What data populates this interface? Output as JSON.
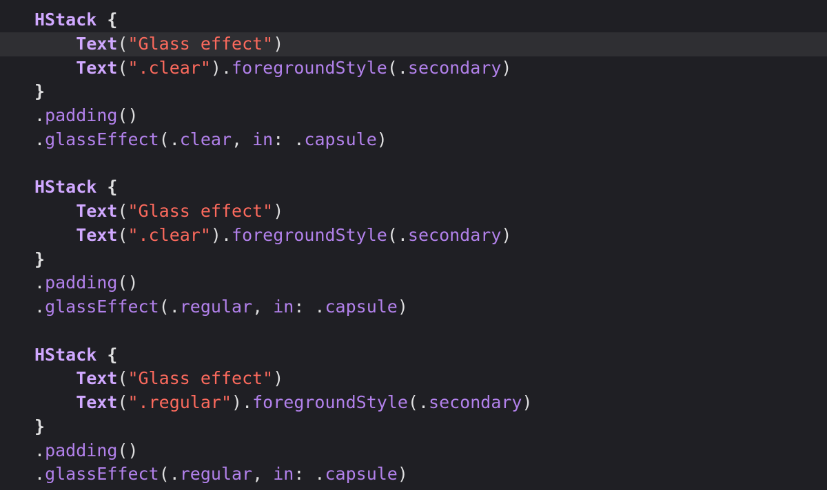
{
  "editor": {
    "theme": {
      "background": "#1f1f24",
      "current_line": "#2f2f33",
      "plain": "#dfdfe0",
      "type": "#d0a8ff",
      "string": "#fc6a5d",
      "method": "#b281eb",
      "keyword": "#fc5fa3"
    },
    "current_line_index": 1,
    "lines": [
      {
        "indent": 0,
        "tokens": [
          {
            "kind": "type",
            "text": "HStack"
          },
          {
            "kind": "plain",
            "text": " "
          },
          {
            "kind": "brace",
            "text": "{"
          }
        ]
      },
      {
        "indent": 1,
        "tokens": [
          {
            "kind": "type",
            "text": "Text"
          },
          {
            "kind": "plain",
            "text": "("
          },
          {
            "kind": "string",
            "text": "\"Glass effect\""
          },
          {
            "kind": "plain",
            "text": ")"
          }
        ]
      },
      {
        "indent": 1,
        "tokens": [
          {
            "kind": "type",
            "text": "Text"
          },
          {
            "kind": "plain",
            "text": "("
          },
          {
            "kind": "string",
            "text": "\".clear\""
          },
          {
            "kind": "plain",
            "text": ")."
          },
          {
            "kind": "method",
            "text": "foregroundStyle"
          },
          {
            "kind": "plain",
            "text": "(."
          },
          {
            "kind": "method",
            "text": "secondary"
          },
          {
            "kind": "plain",
            "text": ")"
          }
        ]
      },
      {
        "indent": 0,
        "tokens": [
          {
            "kind": "brace",
            "text": "}"
          }
        ]
      },
      {
        "indent": 0,
        "tokens": [
          {
            "kind": "plain",
            "text": "."
          },
          {
            "kind": "method",
            "text": "padding"
          },
          {
            "kind": "plain",
            "text": "()"
          }
        ]
      },
      {
        "indent": 0,
        "tokens": [
          {
            "kind": "plain",
            "text": "."
          },
          {
            "kind": "method",
            "text": "glassEffect"
          },
          {
            "kind": "plain",
            "text": "(."
          },
          {
            "kind": "method",
            "text": "clear"
          },
          {
            "kind": "plain",
            "text": ", "
          },
          {
            "kind": "method",
            "text": "in"
          },
          {
            "kind": "plain",
            "text": ": ."
          },
          {
            "kind": "method",
            "text": "capsule"
          },
          {
            "kind": "plain",
            "text": ")"
          }
        ]
      },
      {
        "indent": 0,
        "tokens": []
      },
      {
        "indent": 0,
        "tokens": [
          {
            "kind": "type",
            "text": "HStack"
          },
          {
            "kind": "plain",
            "text": " "
          },
          {
            "kind": "brace",
            "text": "{"
          }
        ]
      },
      {
        "indent": 1,
        "tokens": [
          {
            "kind": "type",
            "text": "Text"
          },
          {
            "kind": "plain",
            "text": "("
          },
          {
            "kind": "string",
            "text": "\"Glass effect\""
          },
          {
            "kind": "plain",
            "text": ")"
          }
        ]
      },
      {
        "indent": 1,
        "tokens": [
          {
            "kind": "type",
            "text": "Text"
          },
          {
            "kind": "plain",
            "text": "("
          },
          {
            "kind": "string",
            "text": "\".clear\""
          },
          {
            "kind": "plain",
            "text": ")."
          },
          {
            "kind": "method",
            "text": "foregroundStyle"
          },
          {
            "kind": "plain",
            "text": "(."
          },
          {
            "kind": "method",
            "text": "secondary"
          },
          {
            "kind": "plain",
            "text": ")"
          }
        ]
      },
      {
        "indent": 0,
        "tokens": [
          {
            "kind": "brace",
            "text": "}"
          }
        ]
      },
      {
        "indent": 0,
        "tokens": [
          {
            "kind": "plain",
            "text": "."
          },
          {
            "kind": "method",
            "text": "padding"
          },
          {
            "kind": "plain",
            "text": "()"
          }
        ]
      },
      {
        "indent": 0,
        "tokens": [
          {
            "kind": "plain",
            "text": "."
          },
          {
            "kind": "method",
            "text": "glassEffect"
          },
          {
            "kind": "plain",
            "text": "(."
          },
          {
            "kind": "method",
            "text": "regular"
          },
          {
            "kind": "plain",
            "text": ", "
          },
          {
            "kind": "method",
            "text": "in"
          },
          {
            "kind": "plain",
            "text": ": ."
          },
          {
            "kind": "method",
            "text": "capsule"
          },
          {
            "kind": "plain",
            "text": ")"
          }
        ]
      },
      {
        "indent": 0,
        "tokens": []
      },
      {
        "indent": 0,
        "tokens": [
          {
            "kind": "type",
            "text": "HStack"
          },
          {
            "kind": "plain",
            "text": " "
          },
          {
            "kind": "brace",
            "text": "{"
          }
        ]
      },
      {
        "indent": 1,
        "tokens": [
          {
            "kind": "type",
            "text": "Text"
          },
          {
            "kind": "plain",
            "text": "("
          },
          {
            "kind": "string",
            "text": "\"Glass effect\""
          },
          {
            "kind": "plain",
            "text": ")"
          }
        ]
      },
      {
        "indent": 1,
        "tokens": [
          {
            "kind": "type",
            "text": "Text"
          },
          {
            "kind": "plain",
            "text": "("
          },
          {
            "kind": "string",
            "text": "\".regular\""
          },
          {
            "kind": "plain",
            "text": ")."
          },
          {
            "kind": "method",
            "text": "foregroundStyle"
          },
          {
            "kind": "plain",
            "text": "(."
          },
          {
            "kind": "method",
            "text": "secondary"
          },
          {
            "kind": "plain",
            "text": ")"
          }
        ]
      },
      {
        "indent": 0,
        "tokens": [
          {
            "kind": "brace",
            "text": "}"
          }
        ]
      },
      {
        "indent": 0,
        "tokens": [
          {
            "kind": "plain",
            "text": "."
          },
          {
            "kind": "method",
            "text": "padding"
          },
          {
            "kind": "plain",
            "text": "()"
          }
        ]
      },
      {
        "indent": 0,
        "tokens": [
          {
            "kind": "plain",
            "text": "."
          },
          {
            "kind": "method",
            "text": "glassEffect"
          },
          {
            "kind": "plain",
            "text": "(."
          },
          {
            "kind": "method",
            "text": "regular"
          },
          {
            "kind": "plain",
            "text": ", "
          },
          {
            "kind": "method",
            "text": "in"
          },
          {
            "kind": "plain",
            "text": ": ."
          },
          {
            "kind": "method",
            "text": "capsule"
          },
          {
            "kind": "plain",
            "text": ")"
          }
        ]
      }
    ]
  }
}
